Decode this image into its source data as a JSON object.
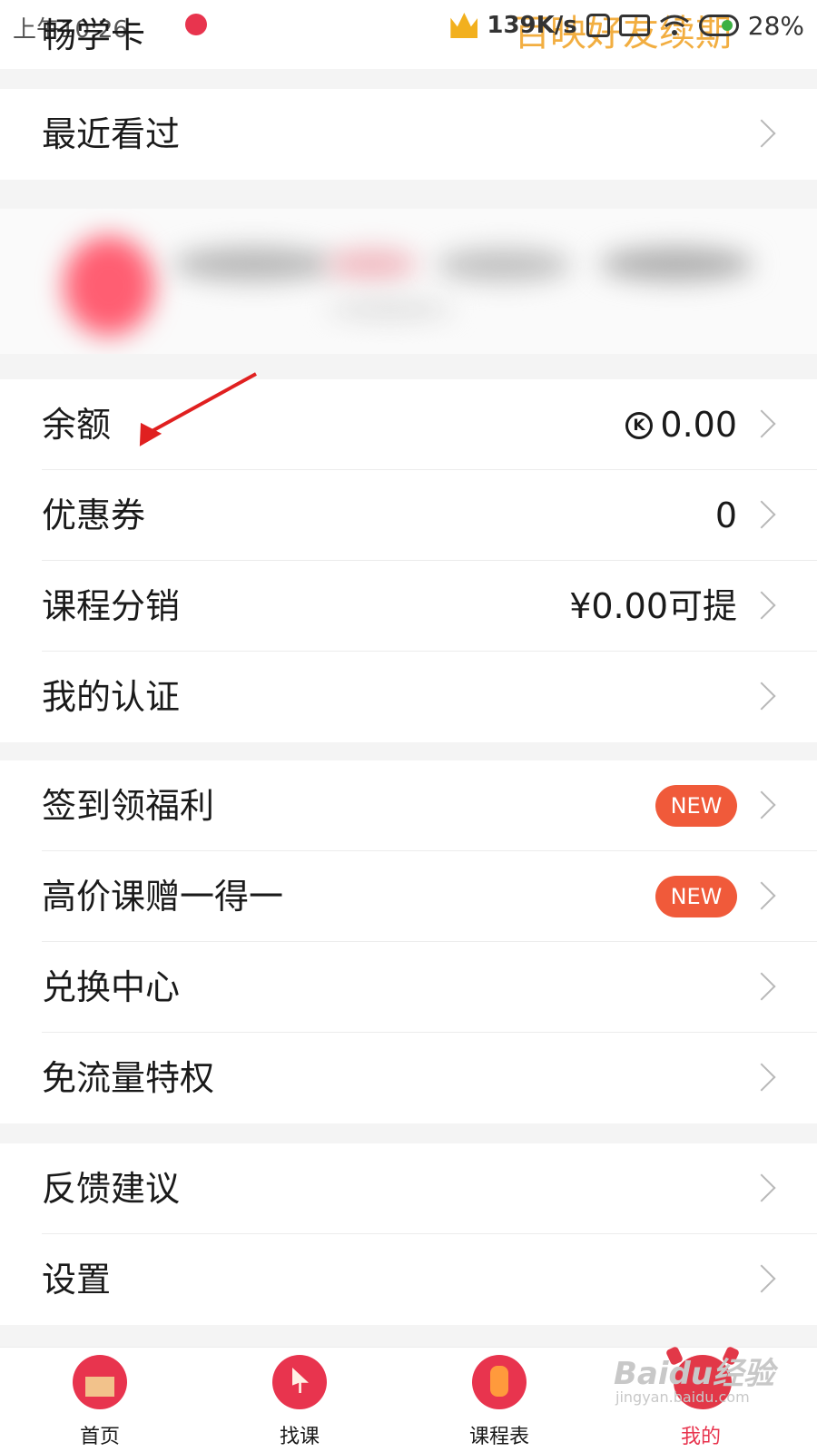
{
  "status_bar": {
    "time": "上午10:26",
    "title": "畅学卡",
    "speed": "139K/s",
    "overlay": "百映好友续期",
    "battery": "28%"
  },
  "recent": {
    "label": "最近看过"
  },
  "wallet": [
    {
      "label": "余额",
      "value": "0.00",
      "icon": "coin-icon"
    },
    {
      "label": "优惠券",
      "value": "0"
    },
    {
      "label": "课程分销",
      "value": "¥0.00可提"
    },
    {
      "label": "我的认证",
      "value": ""
    }
  ],
  "benefits": [
    {
      "label": "签到领福利",
      "badge": "NEW"
    },
    {
      "label": "高价课赠一得一",
      "badge": "NEW"
    },
    {
      "label": "兑换中心"
    },
    {
      "label": "免流量特权"
    }
  ],
  "misc": [
    {
      "label": "反馈建议"
    },
    {
      "label": "设置"
    }
  ],
  "tabbar": [
    {
      "label": "首页",
      "icon": "home-icon"
    },
    {
      "label": "找课",
      "icon": "cursor-icon"
    },
    {
      "label": "课程表",
      "icon": "lantern-icon"
    },
    {
      "label": "我的",
      "icon": "ox-icon",
      "active": true
    }
  ],
  "watermark": {
    "brand": "Baidu经验",
    "url": "jingyan.baidu.com"
  },
  "colors": {
    "accent": "#e8344e",
    "badge": "#f05a3a",
    "background": "#f4f4f4"
  }
}
